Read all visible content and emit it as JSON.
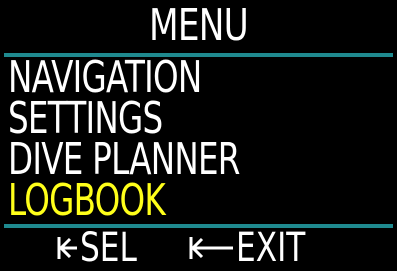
{
  "title": "MENU",
  "menu": {
    "items": [
      {
        "label": "NAVIGATION",
        "selected": false
      },
      {
        "label": "SETTINGS",
        "selected": false
      },
      {
        "label": "DIVE PLANNER",
        "selected": false
      },
      {
        "label": "LOGBOOK",
        "selected": true
      }
    ]
  },
  "footer": {
    "select_label": "SEL",
    "select_icon": "short-back-arrow-icon",
    "exit_label": "EXIT",
    "exit_icon": "long-back-arrow-icon"
  },
  "colors": {
    "background": "#000000",
    "text": "#ffffff",
    "selected": "#ffff1a",
    "divider": "#1f8a8f"
  }
}
